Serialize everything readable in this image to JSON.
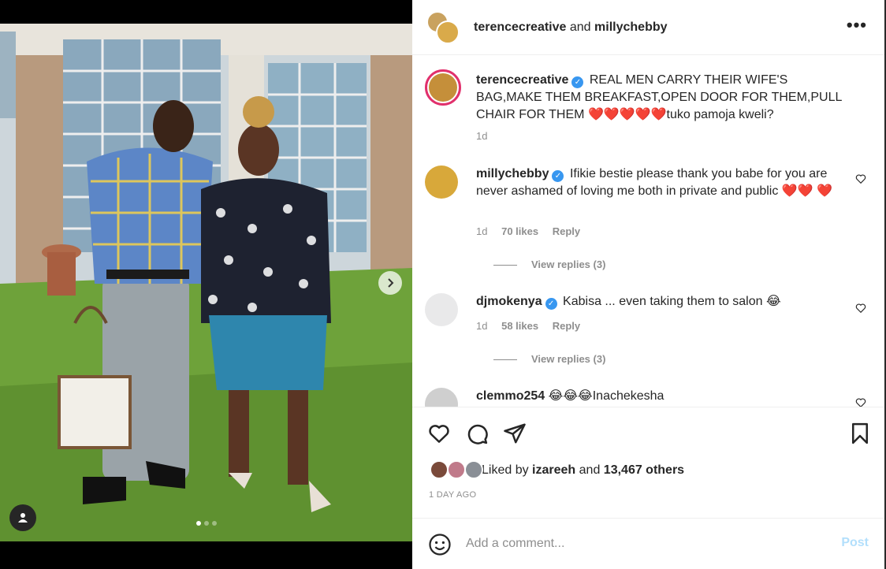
{
  "header": {
    "user1": "terencecreative",
    "and": "and",
    "user2": "millychebby",
    "more": "•••"
  },
  "caption": {
    "username": "terencecreative",
    "text": "REAL MEN CARRY THEIR WIFE'S BAG,MAKE THEM BREAKFAST,OPEN DOOR FOR THEM,PULL CHAIR FOR THEM",
    "hearts": "❤️❤️❤️❤️❤️",
    "text_end": "tuko pamoja kweli?",
    "time": "1d"
  },
  "comments": [
    {
      "username": "millychebby",
      "text": "Ifikie bestie please thank you babe for you are never ashamed of loving me both in private and public",
      "hearts": "❤️❤️ ❤️",
      "time": "1d",
      "likes": "70 likes",
      "reply": "Reply",
      "view_replies": "View replies (3)"
    },
    {
      "username": "djmokenya",
      "text": "Kabisa ... even taking them to salon",
      "emoji": "😂",
      "time": "1d",
      "likes": "58 likes",
      "reply": "Reply",
      "view_replies": "View replies (3)"
    },
    {
      "username": "clemmo254",
      "emoji": "😂😂😂",
      "text": "Inachekesha"
    }
  ],
  "liked": {
    "prefix": "Liked by",
    "user": "izareeh",
    "and": "and",
    "others": "13,467 others"
  },
  "time_ago": "1 DAY AGO",
  "add_comment": {
    "placeholder": "Add a comment...",
    "post": "Post"
  },
  "icons": {
    "heart": "heart-icon",
    "comment": "comment-icon",
    "share": "paper-plane-icon",
    "save": "bookmark-icon",
    "emoji": "smiley-icon",
    "next": "chevron-right-icon",
    "tag": "user-tag-icon"
  },
  "colors": {
    "verified": "#3897f0",
    "post_disabled": "#b2dffc",
    "meta_gray": "#8e8e8e",
    "heart_red": "#e0162b"
  }
}
